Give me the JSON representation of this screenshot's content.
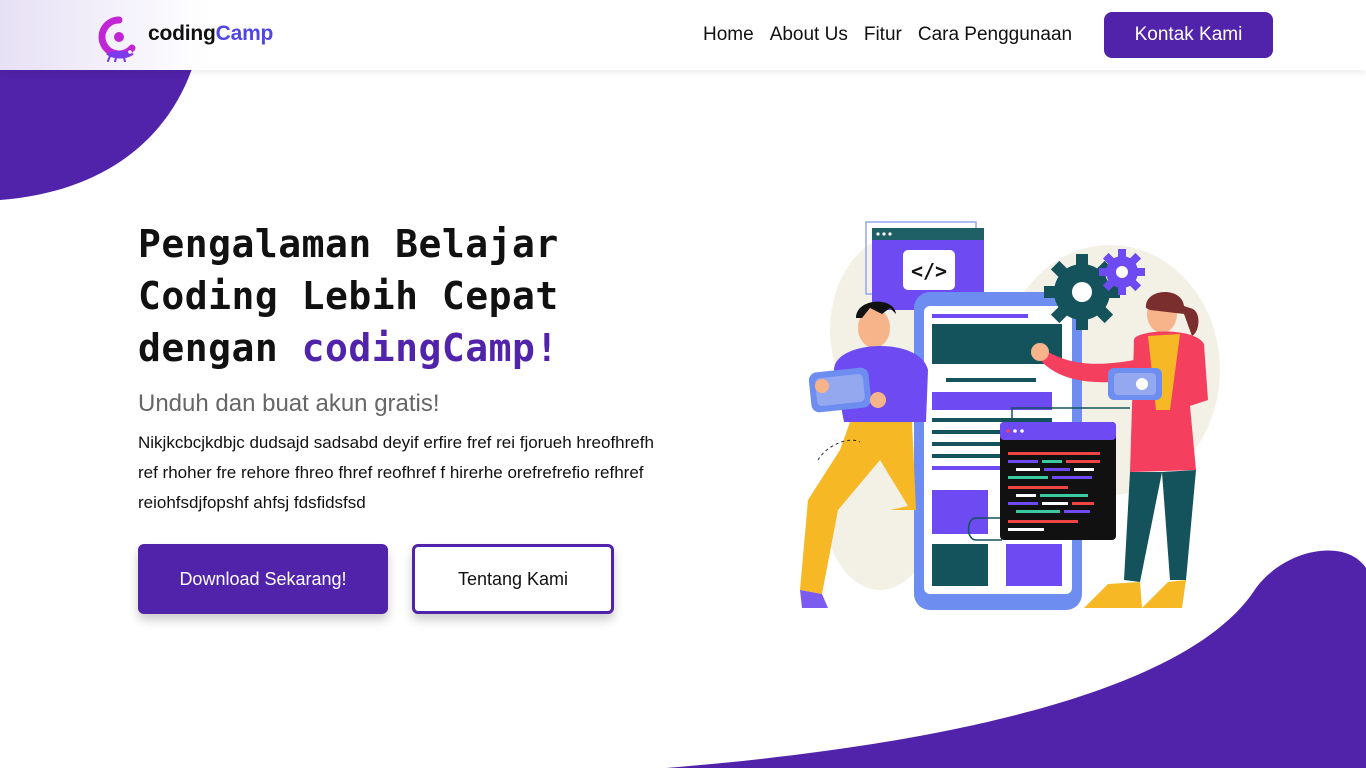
{
  "nav": {
    "brand_part1": "coding",
    "brand_part2": "Camp",
    "links": [
      "Home",
      "About Us",
      "Fitur",
      "Cara Penggunaan"
    ],
    "contact_label": "Kontak Kami"
  },
  "hero": {
    "title_line1": "Pengalaman Belajar",
    "title_line2": "Coding Lebih Cepat",
    "title_line3_prefix": "dengan ",
    "title_brand": "codingCamp!",
    "subtitle": "Unduh dan buat akun gratis!",
    "body": "Nikjkcbcjkdbjc dudsajd sadsabd deyif erfire fref rei fjorueh hreofhrefh ref rhoher fre rehore fhreo fhref reofhref f hirerhe orefrefrefio refhref reiohfsdjfopshf ahfsj fdsfidsfsd",
    "primary_button": "Download Sekarang!",
    "secondary_button": "Tentang Kami"
  },
  "colors": {
    "brand_purple": "#5123ab",
    "logo_accent": "#4f46e5",
    "white": "#ffffff"
  },
  "icons": {
    "logo": "chameleon-logo-icon",
    "illustration": "developers-illustration"
  }
}
